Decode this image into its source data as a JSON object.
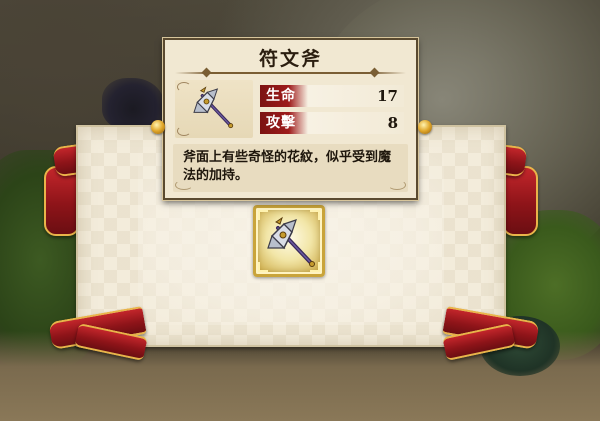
{
  "item": {
    "name": "符文斧",
    "icon": "rune-axe-icon",
    "stats": [
      {
        "label": "生命",
        "value": "17"
      },
      {
        "label": "攻擊",
        "value": "8"
      }
    ],
    "description": "斧面上有些奇怪的花紋，似乎受到魔法的加持。"
  },
  "slot": {
    "icon": "rune-axe-icon"
  },
  "colors": {
    "ribbon": "#a11a1f",
    "ribbon_trim": "#e9b44a",
    "parchment": "#f3ecdb",
    "stat_label_bg": "#8a1616",
    "slot_frame": "#c9a43a"
  }
}
